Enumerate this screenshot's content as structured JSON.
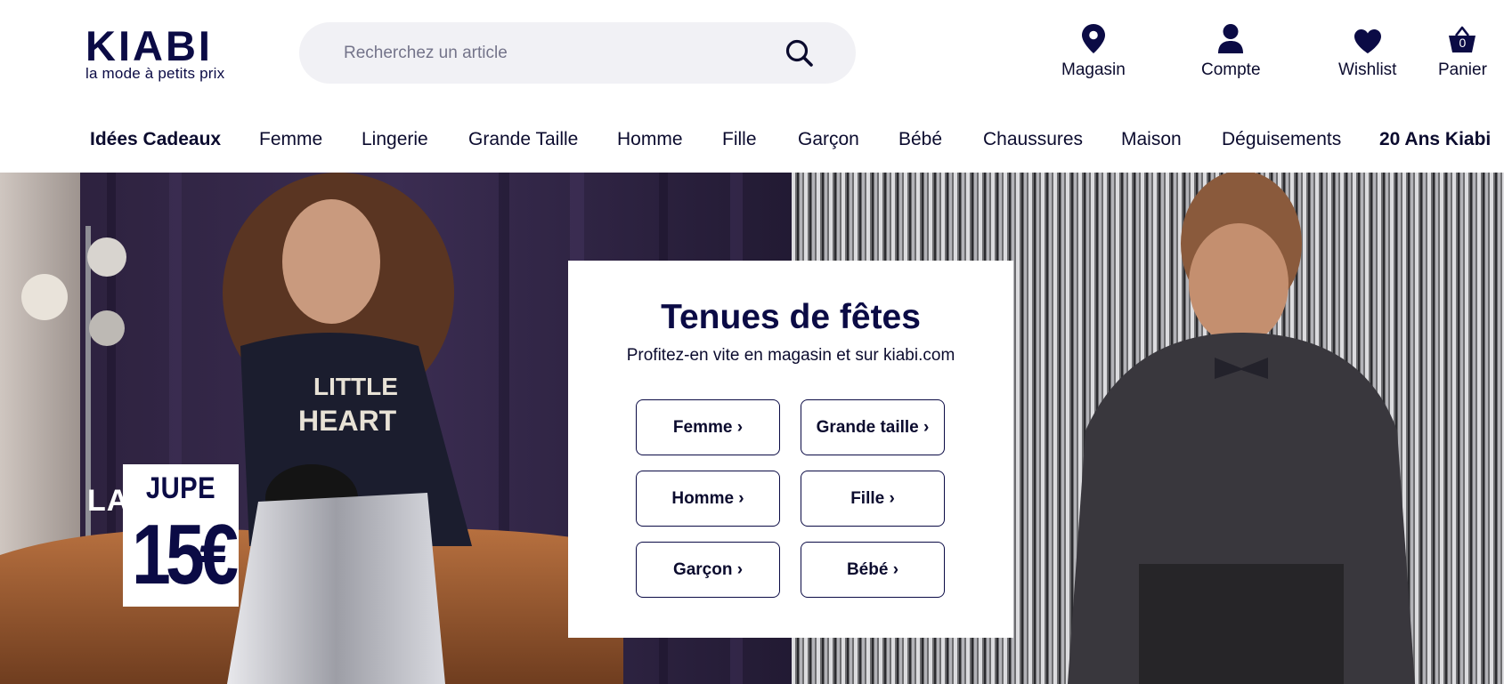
{
  "brand": {
    "logo_word": "KIABI",
    "tagline": "la mode à petits prix",
    "color_primary": "#0b0b45"
  },
  "search": {
    "placeholder": "Recherchez un article",
    "value": "",
    "icon": "search-icon"
  },
  "header_actions": {
    "store": {
      "label": "Magasin",
      "icon": "map-pin-icon"
    },
    "account": {
      "label": "Compte",
      "icon": "user-icon"
    },
    "wishlist": {
      "label": "Wishlist",
      "icon": "heart-icon"
    },
    "cart": {
      "label": "Panier",
      "icon": "basket-icon",
      "count": "0"
    }
  },
  "nav": {
    "items": [
      {
        "label": "Idées Cadeaux",
        "bold": true
      },
      {
        "label": "Femme",
        "bold": false
      },
      {
        "label": "Lingerie",
        "bold": false
      },
      {
        "label": "Grande Taille",
        "bold": false
      },
      {
        "label": "Homme",
        "bold": false
      },
      {
        "label": "Fille",
        "bold": false
      },
      {
        "label": "Garçon",
        "bold": false
      },
      {
        "label": "Bébé",
        "bold": false
      },
      {
        "label": "Chaussures",
        "bold": false
      },
      {
        "label": "Maison",
        "bold": false
      },
      {
        "label": "Déguisements",
        "bold": false
      },
      {
        "label": "20 Ans Kiabi",
        "bold": true
      }
    ]
  },
  "hero": {
    "promo": {
      "prefix": "LA",
      "product": "JUPE",
      "price": "15€"
    },
    "card": {
      "title": "Tenues de fêtes",
      "subtitle": "Profitez-en vite en magasin et sur kiabi.com",
      "buttons": [
        {
          "label": "Femme ›"
        },
        {
          "label": "Grande taille ›"
        },
        {
          "label": "Homme ›"
        },
        {
          "label": "Fille ›"
        },
        {
          "label": "Garçon ›"
        },
        {
          "label": "Bébé ›"
        }
      ]
    }
  }
}
